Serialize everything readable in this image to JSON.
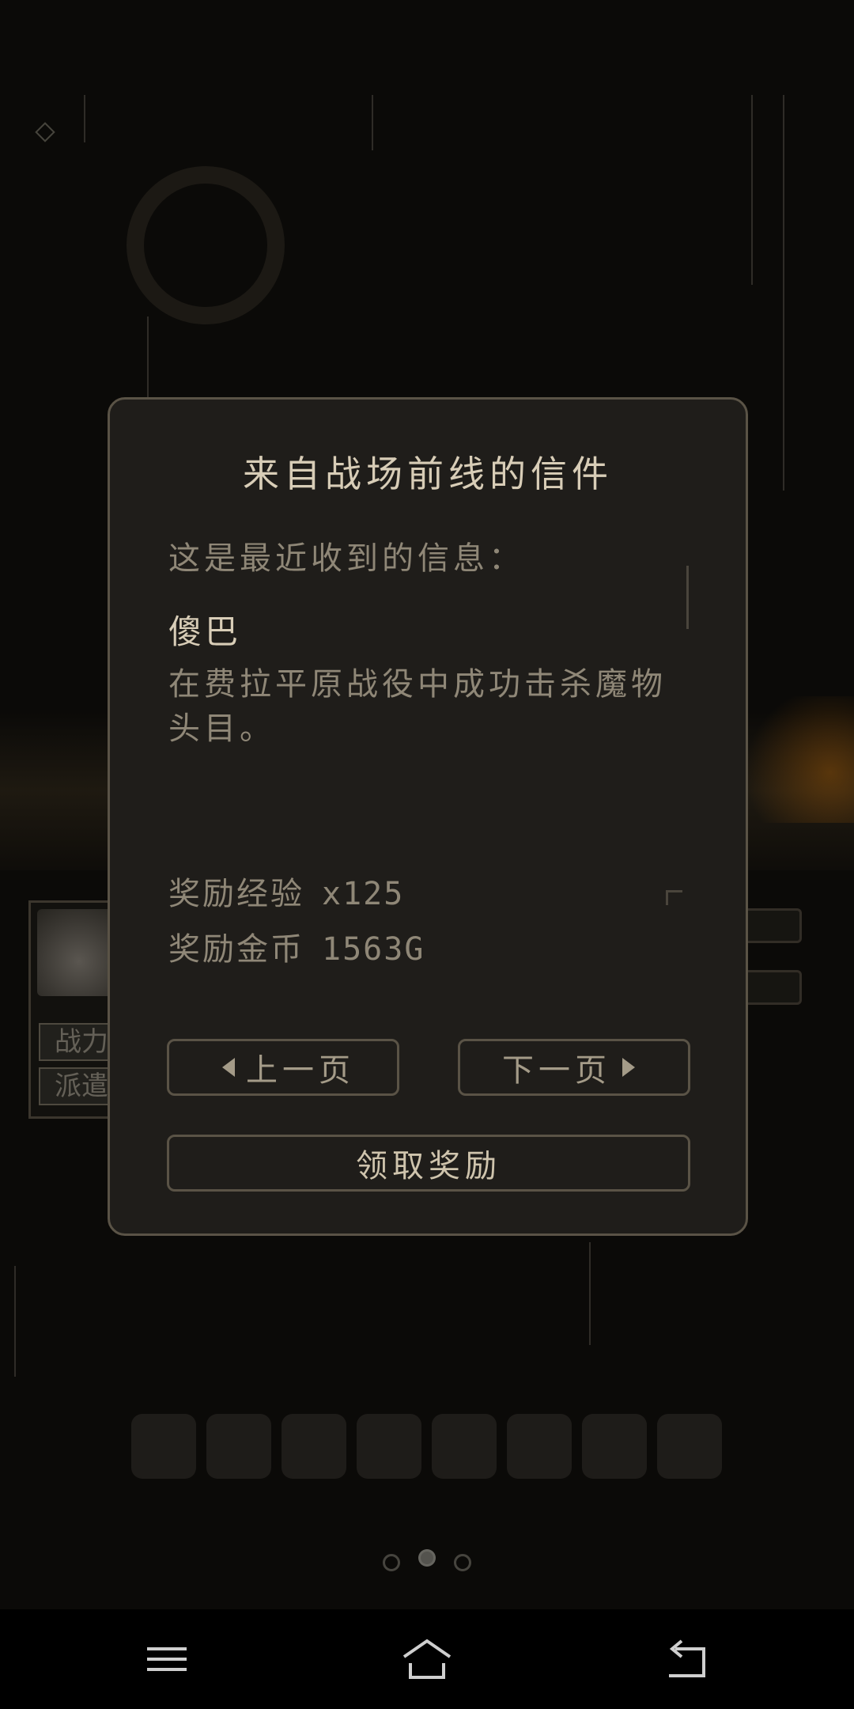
{
  "background": {
    "char_tags": [
      "战力",
      "派遣"
    ],
    "page_indicator": {
      "total": 3,
      "active": 2
    }
  },
  "dialog": {
    "title": "来自战场前线的信件",
    "intro": "这是最近收到的信息：",
    "sender": "傻巴",
    "message": "在费拉平原战役中成功击杀魔物头目。",
    "rewards": [
      {
        "label": "奖励经验",
        "value": "x125"
      },
      {
        "label": "奖励金币",
        "value": "1563G"
      }
    ],
    "prev_label": "上一页",
    "next_label": "下一页",
    "claim_label": "领取奖励"
  },
  "navbar": {
    "icons": [
      "menu-icon",
      "home-icon",
      "back-icon"
    ]
  },
  "colors": {
    "panel_bg": "#1f1d1a",
    "panel_border": "#5a5346",
    "title_text": "#d8cdb7",
    "body_text": "#8f8777"
  }
}
